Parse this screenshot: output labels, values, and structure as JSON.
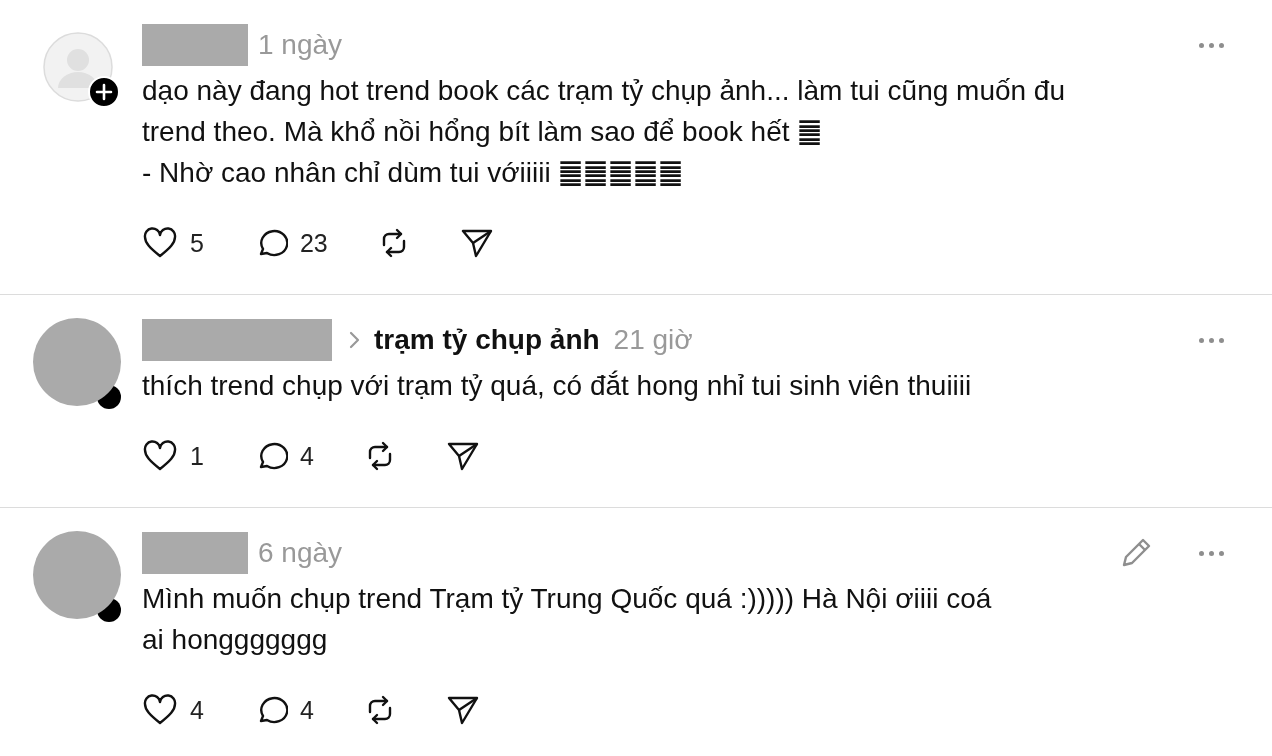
{
  "posts": [
    {
      "avatar": {
        "kind": "default"
      },
      "follow_badge": true,
      "time": "1 ngày",
      "editable": false,
      "text_lines": [
        "dạo này đang hot trend book các trạm tỷ chụp ảnh... làm tui cũng muốn đu",
        "trend theo. Mà khổ nồi hổng bít làm sao để book hết ䷀",
        "- Nhờ cao nhân chỉ dùm tui vớiiiii ䷀䷀䷀䷀䷀"
      ],
      "likes": "5",
      "replies": "23"
    },
    {
      "avatar": {
        "kind": "plain"
      },
      "follow_badge": false,
      "topic": "trạm tỷ chụp ảnh",
      "time": "21 giờ",
      "editable": false,
      "text_lines": [
        "thích trend chụp với trạm tỷ quá, có đắt hong nhỉ tui sinh viên thuiiii"
      ],
      "likes": "1",
      "replies": "4"
    },
    {
      "avatar": {
        "kind": "plain"
      },
      "follow_badge": false,
      "time": "6 ngày",
      "editable": true,
      "text_lines": [
        "Mình muốn chụp trend Trạm tỷ Trung Quốc quá :))))) Hà Nội ơiiii coá",
        "ai honggggggg"
      ],
      "likes": "4",
      "replies": "4"
    }
  ]
}
